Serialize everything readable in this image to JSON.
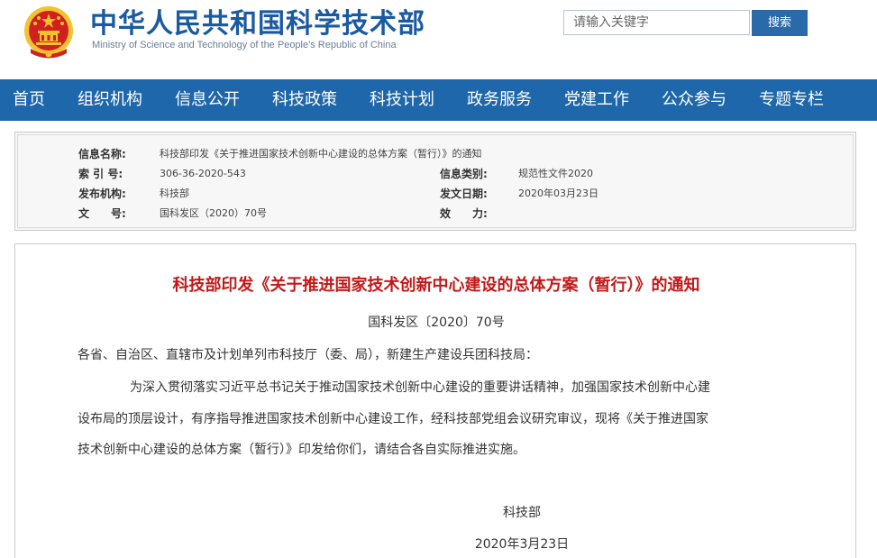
{
  "header": {
    "site_title_cn": "中华人民共和国科学技术部",
    "site_title_en": "Ministry of Science and Technology of the People's Republic of China",
    "search": {
      "placeholder": "请输入关键字",
      "button_label": "搜索"
    },
    "colors": {
      "brand": "#1a5aa0",
      "nav": "#1e67aa",
      "title_red": "#c21818",
      "emblem_red": "#d02020",
      "emblem_gold": "#f2c230"
    },
    "icons": {
      "emblem": "national-emblem-icon"
    }
  },
  "nav": {
    "items": [
      "首页",
      "组织机构",
      "信息公开",
      "科技政策",
      "科技计划",
      "政务服务",
      "党建工作",
      "公众参与",
      "专题专栏"
    ]
  },
  "meta": {
    "info_name_label": "信息名称:",
    "info_name_value": "科技部印发《关于推进国家技术创新中心建设的总体方案（暂行）》的通知",
    "index_label": "索 引 号:",
    "index_value": "306-36-2020-543",
    "category_label": "信息类别:",
    "category_value": "规范性文件2020",
    "publisher_label": "发布机构:",
    "publisher_value": "科技部",
    "date_label": "发文日期:",
    "date_value": "2020年03月23日",
    "docno_label": "文　　号:",
    "docno_value": "国科发区（2020）70号",
    "validity_label": "效　　力:",
    "validity_value": ""
  },
  "article": {
    "title": "科技部印发《关于推进国家技术创新中心建设的总体方案（暂行）》的通知",
    "doc_number": "国科发区〔2020〕70号",
    "addressee": "各省、自治区、直辖市及计划单列市科技厅（委、局），新建生产建设兵团科技局：",
    "body_lines": [
      "为深入贯彻落实习近平总书记关于推动国家技术创新中心建设的重要讲话精神，加强国家技术创新中心建",
      "设布局的顶层设计，有序指导推进国家技术创新中心建设工作，经科技部党组会议研究审议，现将《关于推进国家",
      "技术创新中心建设的总体方案（暂行）》印发给你们，请结合各自实际推进实施。"
    ],
    "signature": "科技部",
    "sign_date": "2020年3月23日"
  }
}
